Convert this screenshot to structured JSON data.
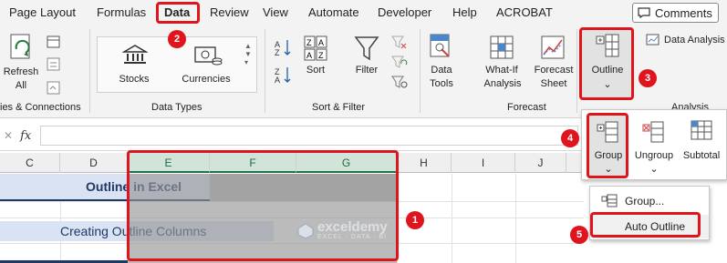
{
  "menubar": {
    "tabs": [
      "Page Layout",
      "Formulas",
      "Data",
      "Review",
      "View",
      "Automate",
      "Developer",
      "Help",
      "ACROBAT"
    ],
    "comments_label": "Comments"
  },
  "ribbon": {
    "refresh_label": "Refresh",
    "refresh_all_label": "All",
    "queries_group": "ies & Connections",
    "stocks_label": "Stocks",
    "currencies_label": "Currencies",
    "data_types_group": "Data Types",
    "sort_label": "Sort",
    "filter_label": "Filter",
    "sort_filter_group": "Sort & Filter",
    "data_tools_label_1": "Data",
    "data_tools_label_2": "Tools",
    "whatif_label_1": "What-If",
    "whatif_label_2": "Analysis",
    "forecast_sheet_label_1": "Forecast",
    "forecast_sheet_label_2": "Sheet",
    "forecast_group": "Forecast",
    "outline_label": "Outline",
    "data_analysis_label": "Data Analysis",
    "analysis_group": "Analysis"
  },
  "outline_panel": {
    "group_label": "Group",
    "ungroup_label": "Ungroup",
    "subtotal_label": "Subtotal"
  },
  "group_menu": {
    "items": [
      "Group...",
      "Auto Outline"
    ]
  },
  "formula_bar": {
    "fx_label": "fx",
    "cancel_glyph": "✕"
  },
  "grid": {
    "columns": [
      "C",
      "D",
      "E",
      "F",
      "G",
      "H",
      "I",
      "J"
    ],
    "title_cell": "Outline in Excel",
    "subtitle_cell": "Creating Outline Columns"
  },
  "watermark": {
    "name": "exceldemy",
    "tagline": "EXCEL · DATA · BI"
  },
  "callouts": [
    "1",
    "2",
    "3",
    "4",
    "5"
  ],
  "colors": {
    "accent_red": "#e0141c",
    "excel_green": "#217346",
    "header_fill": "#dae3f3",
    "selection_fill": "#bfbfbf"
  }
}
